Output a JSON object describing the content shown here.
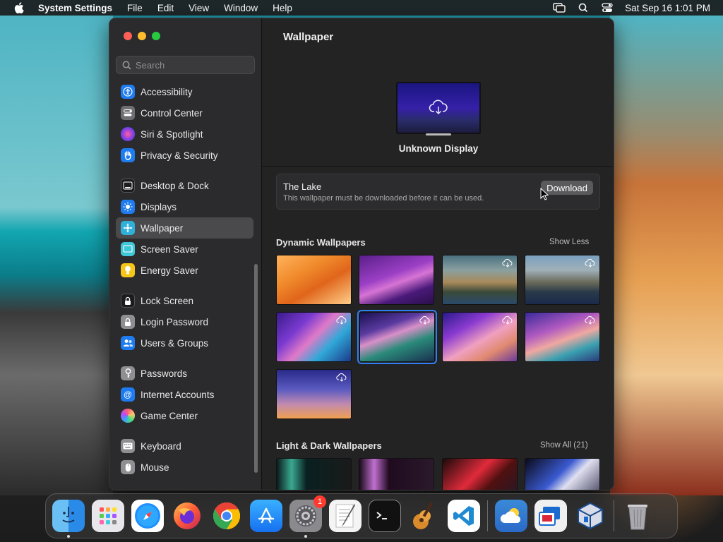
{
  "menubar": {
    "app_name": "System Settings",
    "items": [
      "File",
      "Edit",
      "View",
      "Window",
      "Help"
    ],
    "clock": "Sat Sep 16  1:01 PM"
  },
  "sidebar": {
    "search_placeholder": "Search",
    "items": [
      {
        "label": "Accessibility",
        "icon": "accessibility-icon",
        "color": "#1f7cf0"
      },
      {
        "label": "Control Center",
        "icon": "control-center-icon",
        "color": "#6e6e73"
      },
      {
        "label": "Siri & Spotlight",
        "icon": "siri-icon",
        "color": "#b14de0"
      },
      {
        "label": "Privacy & Security",
        "icon": "hand-icon",
        "color": "#1f7cf0"
      },
      {
        "label": "Desktop & Dock",
        "icon": "desktop-dock-icon",
        "color": "#1c1c1e"
      },
      {
        "label": "Displays",
        "icon": "displays-icon",
        "color": "#1f7cf0"
      },
      {
        "label": "Wallpaper",
        "icon": "wallpaper-icon",
        "color": "#30b0d9"
      },
      {
        "label": "Screen Saver",
        "icon": "screen-saver-icon",
        "color": "#40c8d8"
      },
      {
        "label": "Energy Saver",
        "icon": "energy-saver-icon",
        "color": "#f5c518"
      },
      {
        "label": "Lock Screen",
        "icon": "lock-screen-icon",
        "color": "#1c1c1e"
      },
      {
        "label": "Login Password",
        "icon": "login-password-icon",
        "color": "#8e8e93"
      },
      {
        "label": "Users & Groups",
        "icon": "users-groups-icon",
        "color": "#1f7cf0"
      },
      {
        "label": "Passwords",
        "icon": "key-icon",
        "color": "#8e8e93"
      },
      {
        "label": "Internet Accounts",
        "icon": "at-icon",
        "color": "#1f7cf0"
      },
      {
        "label": "Game Center",
        "icon": "game-center-icon",
        "color": "#e24a8a"
      },
      {
        "label": "Keyboard",
        "icon": "keyboard-icon",
        "color": "#8e8e93"
      },
      {
        "label": "Mouse",
        "icon": "mouse-icon",
        "color": "#8e8e93"
      }
    ],
    "active": "Wallpaper"
  },
  "main": {
    "title": "Wallpaper",
    "display_label": "Unknown Display",
    "notice": {
      "title": "The Lake",
      "description": "This wallpaper must be downloaded before it can be used.",
      "button": "Download"
    },
    "dynamic": {
      "title": "Dynamic Wallpapers",
      "link": "Show Less"
    },
    "light_dark": {
      "title": "Light & Dark Wallpapers",
      "link": "Show All (21)"
    }
  },
  "dock": {
    "items": [
      "Finder",
      "Launchpad",
      "Safari",
      "Firefox",
      "Chrome",
      "App Store",
      "System Settings",
      "TextEdit",
      "Terminal",
      "GarageBand",
      "VS Code",
      "Weather",
      "Remote Desktop",
      "VirtualBox",
      "Trash"
    ],
    "system_settings_badge": "1"
  },
  "colors": {
    "accent": "#2f7ef5",
    "window_bg": "#1e1e1e",
    "sidebar_bg": "#2b2b2d"
  }
}
